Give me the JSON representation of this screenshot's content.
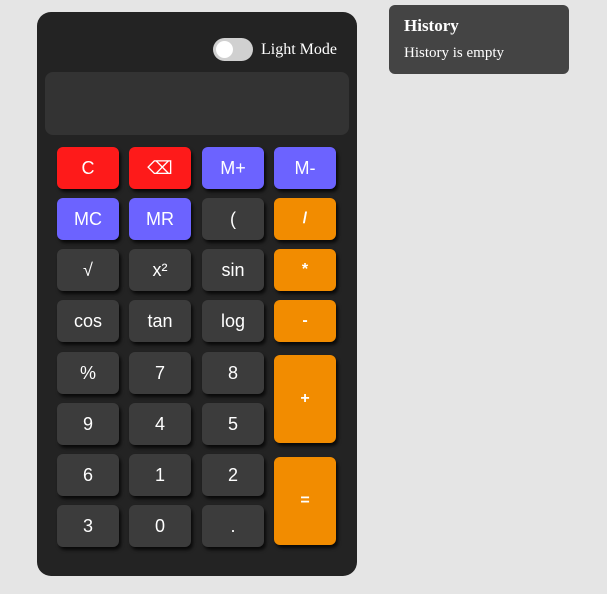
{
  "mode": {
    "label": "Light Mode"
  },
  "display": {
    "value": ""
  },
  "buttons": {
    "clear": "C",
    "backspace": "⌫",
    "m_plus": "M+",
    "m_minus": "M-",
    "mc": "MC",
    "mr": "MR",
    "open_paren": "(",
    "divide": "/",
    "sqrt": "√",
    "square": "x²",
    "sin": "sin",
    "multiply": "*",
    "cos": "cos",
    "tan": "tan",
    "log": "log",
    "subtract": "-",
    "percent": "%",
    "seven": "7",
    "eight": "8",
    "add": "+",
    "nine": "9",
    "four": "4",
    "five": "5",
    "six": "6",
    "one": "1",
    "two": "2",
    "equals": "=",
    "three": "3",
    "zero": "0",
    "decimal": "."
  },
  "history": {
    "title": "History",
    "empty_text": "History is empty"
  },
  "colors": {
    "page_bg": "#e5e5e5",
    "calculator_bg": "#232323",
    "display_bg": "#333333",
    "red": "#fe1a1a",
    "purple": "#6c63ff",
    "dark": "#3c3c3c",
    "orange": "#f28c00",
    "history_bg": "#444444"
  }
}
